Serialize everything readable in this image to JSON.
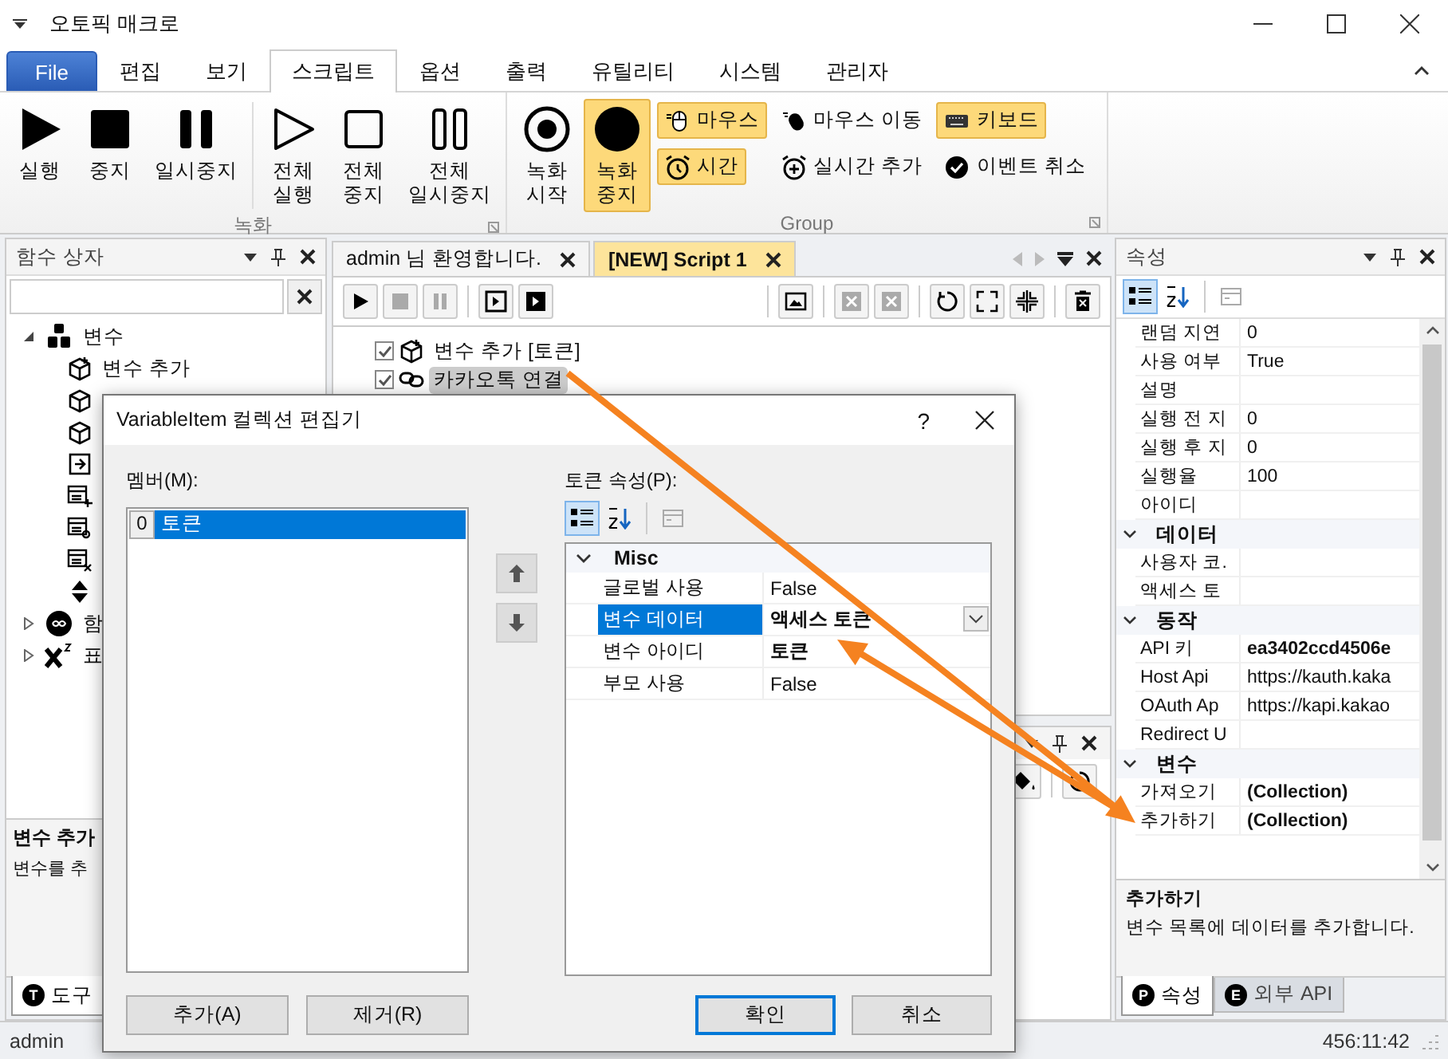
{
  "window": {
    "title": "오토픽 매크로"
  },
  "ribbon_tabs": [
    {
      "label": "File",
      "kind": "file",
      "selected": false
    },
    {
      "label": "편집",
      "kind": "tab",
      "selected": false
    },
    {
      "label": "보기",
      "kind": "tab",
      "selected": false
    },
    {
      "label": "스크립트",
      "kind": "tab",
      "selected": true
    },
    {
      "label": "옵션",
      "kind": "tab",
      "selected": false
    },
    {
      "label": "출력",
      "kind": "tab",
      "selected": false
    },
    {
      "label": "유틸리티",
      "kind": "tab",
      "selected": false
    },
    {
      "label": "시스템",
      "kind": "tab",
      "selected": false
    },
    {
      "label": "관리자",
      "kind": "tab",
      "selected": false
    }
  ],
  "ribbon_groups": [
    {
      "label": "녹화",
      "sections": [
        [
          {
            "kind": "play",
            "lines": [
              "실행"
            ],
            "on": false
          },
          {
            "kind": "stop",
            "lines": [
              "중지"
            ],
            "on": false
          },
          {
            "kind": "pause",
            "lines": [
              "일시중지"
            ],
            "on": false
          }
        ],
        [
          {
            "kind": "play-outline",
            "lines": [
              "전체",
              "실행"
            ],
            "on": false
          },
          {
            "kind": "stop-outline",
            "lines": [
              "전체",
              "중지"
            ],
            "on": false
          },
          {
            "kind": "pause-outline",
            "lines": [
              "전체",
              "일시중지"
            ],
            "on": false
          }
        ]
      ]
    },
    {
      "label": "Group",
      "sections": [
        [
          {
            "kind": "record",
            "lines": [
              "녹화",
              "시작"
            ],
            "on": false
          },
          {
            "kind": "record-filled",
            "lines": [
              "녹화",
              "중지"
            ],
            "on": true
          }
        ]
      ],
      "small": [
        {
          "kind": "mouse",
          "label": "마우스",
          "on": true
        },
        {
          "kind": "mouse-move",
          "label": "마우스 이동",
          "on": false
        },
        {
          "kind": "keyboard",
          "label": "키보드",
          "on": true
        },
        {
          "kind": "clock",
          "label": "시간",
          "on": true
        },
        {
          "kind": "clock-add",
          "label": "실시간 추가",
          "on": false
        },
        {
          "kind": "check",
          "label": "이벤트 취소",
          "on": false
        }
      ]
    }
  ],
  "function_box": {
    "title": "함수 상자",
    "tree": [
      {
        "label": "변수",
        "kind": "variables",
        "expanded": true,
        "children": [
          {
            "kind": "box-add",
            "label": "변수 추가"
          },
          {
            "kind": "box-edit"
          },
          {
            "kind": "box-remove"
          },
          {
            "kind": "input"
          },
          {
            "kind": "list-add"
          },
          {
            "kind": "list-find"
          },
          {
            "kind": "list-remove"
          },
          {
            "kind": "sort"
          }
        ]
      },
      {
        "label": "함",
        "kind": "function",
        "expanded": false
      },
      {
        "label": "표",
        "kind": "power",
        "expanded": false
      }
    ],
    "description": {
      "title": "변수 추가",
      "text": "변수를 추"
    },
    "tabs": [
      {
        "badge": "T",
        "label": "도구",
        "selected": true
      }
    ]
  },
  "editor": {
    "tabs": [
      {
        "label": "admin 님 환영합니다.",
        "selected": false
      },
      {
        "label": "[NEW] Script 1",
        "selected": true
      }
    ],
    "toolbar": [
      [
        {
          "kind": "play",
          "disabled": false
        },
        {
          "kind": "stop",
          "disabled": true
        },
        {
          "kind": "pause",
          "disabled": true
        }
      ],
      [
        {
          "kind": "play-box",
          "disabled": false
        },
        {
          "kind": "play-filled-box",
          "disabled": false
        }
      ],
      [
        {
          "kind": "image",
          "disabled": false
        }
      ],
      [
        {
          "kind": "cross",
          "disabled": true
        },
        {
          "kind": "cross",
          "disabled": true
        }
      ],
      [
        {
          "kind": "circle-arrow",
          "disabled": false
        },
        {
          "kind": "expand",
          "disabled": false
        },
        {
          "kind": "collapse",
          "disabled": false
        }
      ],
      [
        {
          "kind": "trash",
          "disabled": false
        }
      ]
    ],
    "rows": [
      {
        "kind": "box-add",
        "label": "변수 추가 [토큰]",
        "checked": true,
        "selected": false
      },
      {
        "kind": "link",
        "label": "카카오톡 연결",
        "checked": true,
        "selected": true
      }
    ]
  },
  "properties": {
    "title": "속성",
    "rows": [
      {
        "name": "랜덤 지연",
        "value": "0",
        "modified": false
      },
      {
        "name": "사용 여부",
        "value": "True",
        "modified": false
      },
      {
        "name": "설명",
        "value": ""
      },
      {
        "name": "실행 전 지",
        "value": "0",
        "modified": false
      },
      {
        "name": "실행 후 지",
        "value": "0",
        "modified": false
      },
      {
        "name": "실행율",
        "value": "100",
        "modified": false
      },
      {
        "name": "아이디",
        "value": ""
      }
    ],
    "categories": [
      {
        "name": "데이터",
        "expanded": true,
        "rows": [
          {
            "name": "사용자 코.",
            "value": ""
          },
          {
            "name": "액세스 토",
            "value": ""
          }
        ]
      },
      {
        "name": "동작",
        "expanded": true,
        "rows": [
          {
            "name": "API 키",
            "value": "ea3402ccd4506e",
            "modified": true
          },
          {
            "name": "Host Api",
            "value": "https://kauth.kaka",
            "modified": false
          },
          {
            "name": "OAuth Ap",
            "value": "https://kapi.kakao",
            "modified": false
          },
          {
            "name": "Redirect U",
            "value": ""
          }
        ]
      },
      {
        "name": "변수",
        "expanded": true,
        "rows": [
          {
            "name": "가져오기",
            "value": "(Collection)",
            "modified": true
          },
          {
            "name": "추가하기",
            "value": "(Collection)",
            "modified": true
          }
        ]
      }
    ],
    "description": {
      "title": "추가하기",
      "text": "변수 목록에 데이터를 추가합니다."
    },
    "tabs": [
      {
        "badge": "P",
        "label": "속성",
        "selected": true
      },
      {
        "badge": "E",
        "label": "외부 API",
        "selected": false
      }
    ]
  },
  "dialog": {
    "title": "VariableItem 컬렉션 편집기",
    "help": "?",
    "members_label": "멤버(M):",
    "members": [
      {
        "index": "0",
        "label": "토큰",
        "selected": true
      }
    ],
    "props_label": "토큰 속성(P):",
    "category": {
      "name": "Misc",
      "expanded": true
    },
    "rows": [
      {
        "name": "글로벌 사용",
        "value": "False",
        "modified": false,
        "selected": false
      },
      {
        "name": "변수 데이터",
        "value": "액세스 토큰",
        "modified": true,
        "selected": true
      },
      {
        "name": "변수 아이디",
        "value": "토큰",
        "modified": true,
        "selected": false
      },
      {
        "name": "부모 사용",
        "value": "False",
        "modified": false,
        "selected": false
      }
    ],
    "add_button": "추가(A)",
    "remove_button": "제거(R)",
    "ok_button": "확인",
    "cancel_button": "취소"
  },
  "status_bar": {
    "user": "admin",
    "time": "456:11:42"
  }
}
